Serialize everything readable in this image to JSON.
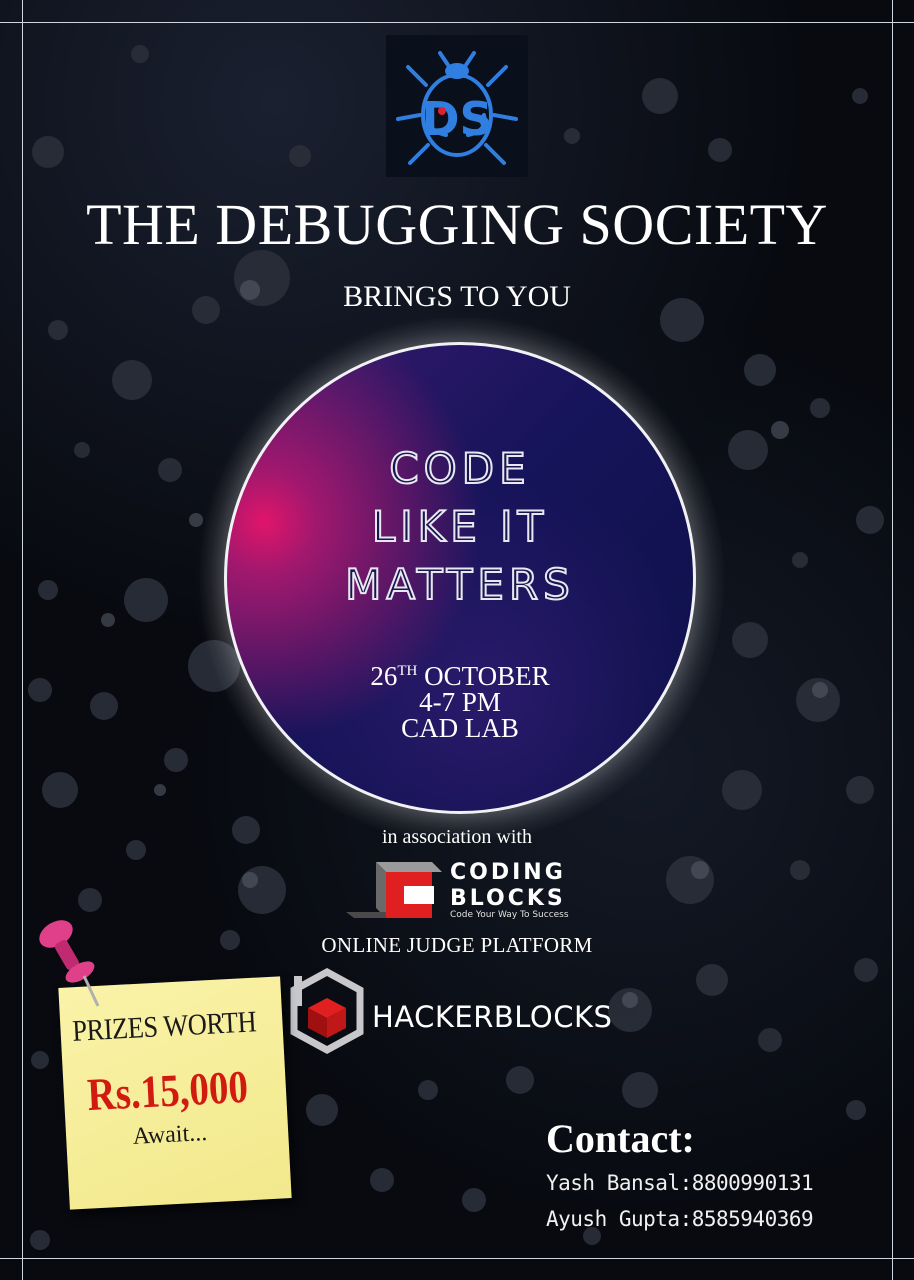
{
  "org_title": "THE DEBUGGING SOCIETY",
  "subtitle": "BRINGS TO YOU",
  "logo_text": "DS",
  "headline": [
    "CODE",
    "LIKE IT",
    "MATTERS"
  ],
  "event": {
    "date_day": "26",
    "date_suffix": "TH",
    "date_month": "OCTOBER",
    "time": "4-7 PM",
    "venue": "CAD LAB"
  },
  "association": {
    "label": "in association with",
    "partner_name_line1": "CODING",
    "partner_name_line2": "BLOCKS",
    "partner_tagline": "Code Your Way To Success"
  },
  "judge": {
    "label": "ONLINE JUDGE PLATFORM",
    "platform_name": "HACKERBLOCKS"
  },
  "prize": {
    "line1": "PRIZES WORTH",
    "amount": "Rs.15,000",
    "line3": "Await..."
  },
  "contact": {
    "title": "Contact:",
    "people": [
      "Yash Bansal:8800990131",
      "Ayush Gupta:8585940369"
    ]
  },
  "colors": {
    "background": "#080a10",
    "circle_deep": "#16145a",
    "circle_glow": "#e0156a",
    "prize_red": "#d11a10",
    "note_yellow": "#f6ee9c",
    "pin_pink": "#e0408a",
    "logo_blue": "#2f7ee0",
    "cb_red": "#e02020"
  },
  "icons": {
    "logo": "bug-icon",
    "partner": "coding-blocks-logo",
    "platform": "hackerblocks-cube-icon",
    "pin": "pushpin-icon"
  }
}
